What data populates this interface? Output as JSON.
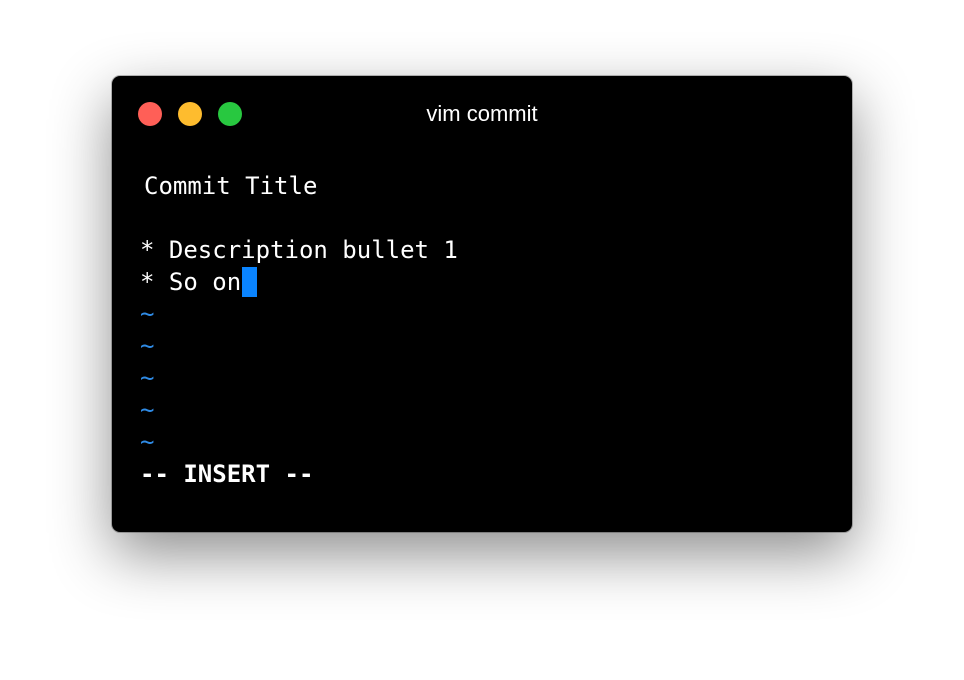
{
  "window": {
    "title": "vim commit"
  },
  "editor": {
    "lines": [
      "Commit Title",
      "",
      "* Description bullet 1",
      "* So on"
    ],
    "empty_line_marker": "~",
    "mode_indicator": "-- INSERT --",
    "cursor_color": "#0a84ff"
  },
  "colors": {
    "background": "#000000",
    "text": "#ffffff",
    "tilde": "#2f8be6"
  }
}
